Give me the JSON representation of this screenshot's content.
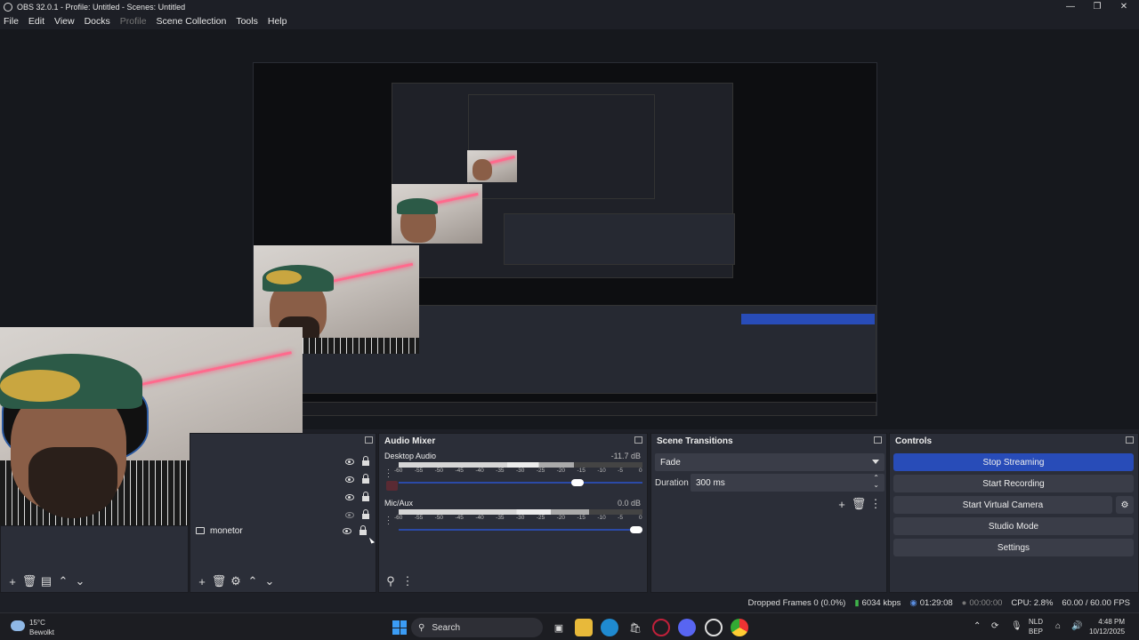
{
  "window": {
    "title": "OBS 32.0.1 - Profile: Untitled - Scenes: Untitled",
    "minimize": "—",
    "maximize": "❐",
    "close": "✕"
  },
  "menu": [
    "File",
    "Edit",
    "View",
    "Docks",
    "Profile",
    "Scene Collection",
    "Tools",
    "Help"
  ],
  "sources": {
    "visible_source": "monetor"
  },
  "audio_mixer": {
    "title": "Audio Mixer",
    "tracks": [
      {
        "name": "Desktop Audio",
        "db": "-11.7 dB",
        "level": 0.72,
        "volume": 0.76
      },
      {
        "name": "Mic/Aux",
        "db": "0.0 dB",
        "level": 0.78,
        "volume": 1.0
      }
    ],
    "ticks": [
      "-60",
      "-55",
      "-50",
      "-45",
      "-40",
      "-35",
      "-30",
      "-25",
      "-20",
      "-15",
      "-10",
      "-5",
      "0"
    ]
  },
  "scene_transitions": {
    "title": "Scene Transitions",
    "transition": "Fade",
    "duration_label": "Duration",
    "duration_value": "300 ms"
  },
  "controls": {
    "title": "Controls",
    "stop_streaming": "Stop Streaming",
    "start_recording": "Start Recording",
    "start_virtual_camera": "Start Virtual Camera",
    "studio_mode": "Studio Mode",
    "settings": "Settings"
  },
  "status": {
    "dropped_frames": "Dropped Frames 0 (0.0%)",
    "bitrate": "6034 kbps",
    "stream_time": "01:29:08",
    "record_time": "00:00:00",
    "cpu": "CPU: 2.8%",
    "fps": "60.00 / 60.00 FPS"
  },
  "taskbar": {
    "weather_temp": "15°C",
    "weather_desc": "Bewolkt",
    "search_placeholder": "Search",
    "lang_line1": "NLD",
    "lang_line2": "BEP",
    "time": "4:48 PM",
    "date": "10/12/2025"
  },
  "colors": {
    "accent": "#284cb8",
    "panel": "#2b2e38",
    "background": "#1d1f26"
  }
}
